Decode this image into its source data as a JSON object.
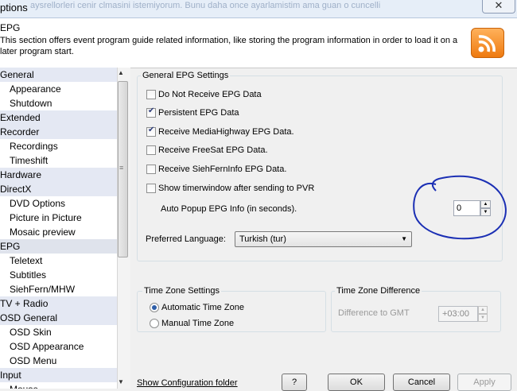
{
  "window": {
    "title": "ptions",
    "ghost_text": "aysrellorleri cenir clmasini istemiyorum. Bunu daha once ayarlamistim ama guan o cuncelli",
    "close_glyph": "✕"
  },
  "header": {
    "title": "EPG",
    "description": "This section offers event program guide related information, like storing the program information in order to load it on a later program start."
  },
  "sidebar": {
    "items": [
      {
        "label": "General",
        "level": 0
      },
      {
        "label": "Appearance",
        "level": 1
      },
      {
        "label": "Shutdown",
        "level": 1
      },
      {
        "label": "Extended",
        "level": 0
      },
      {
        "label": "Recorder",
        "level": 0
      },
      {
        "label": "Recordings",
        "level": 1
      },
      {
        "label": "Timeshift",
        "level": 1
      },
      {
        "label": "Hardware",
        "level": 0
      },
      {
        "label": "DirectX",
        "level": 0
      },
      {
        "label": "DVD Options",
        "level": 1
      },
      {
        "label": "Picture in Picture",
        "level": 1
      },
      {
        "label": "Mosaic preview",
        "level": 1
      },
      {
        "label": "EPG",
        "level": 0,
        "selected": true
      },
      {
        "label": "Teletext",
        "level": 1
      },
      {
        "label": "Subtitles",
        "level": 1
      },
      {
        "label": "SiehFern/MHW",
        "level": 1
      },
      {
        "label": "TV + Radio",
        "level": 0
      },
      {
        "label": "OSD General",
        "level": 0
      },
      {
        "label": "OSD Skin",
        "level": 1
      },
      {
        "label": "OSD Appearance",
        "level": 1
      },
      {
        "label": "OSD Menu",
        "level": 1
      },
      {
        "label": "Input",
        "level": 0
      },
      {
        "label": "Mouse",
        "level": 1
      }
    ],
    "scroll_up": "▲",
    "scroll_down": "▼",
    "grip": "≡"
  },
  "general_epg": {
    "title": "General EPG Settings",
    "checkboxes": [
      {
        "label": "Do Not Receive EPG Data",
        "checked": false
      },
      {
        "label": "Persistent EPG Data",
        "checked": true
      },
      {
        "label": "Receive MediaHighway EPG Data.",
        "checked": true
      },
      {
        "label": "Receive FreeSat EPG Data.",
        "checked": false
      },
      {
        "label": "Receive SiehFernInfo EPG Data.",
        "checked": false
      },
      {
        "label": "Show timerwindow after sending to PVR",
        "checked": false
      }
    ],
    "auto_popup_label": "Auto Popup EPG Info (in seconds).",
    "auto_popup_value": "0",
    "preferred_language_label": "Preferred Language:",
    "preferred_language_value": "Turkish (tur)"
  },
  "timezone": {
    "title": "Time Zone Settings",
    "options": [
      {
        "label": "Automatic Time Zone",
        "selected": true
      },
      {
        "label": "Manual Time Zone",
        "selected": false
      }
    ],
    "difference_title": "Time Zone Difference",
    "difference_label": "Difference to GMT",
    "difference_value": "+03:00"
  },
  "footer": {
    "config_link": "Show Configuration folder",
    "help_label": "?",
    "ok_label": "OK",
    "cancel_label": "Cancel",
    "apply_label": "Apply"
  },
  "colors": {
    "annotation": "#1b2fb4",
    "accent": "#2e5ea8"
  }
}
